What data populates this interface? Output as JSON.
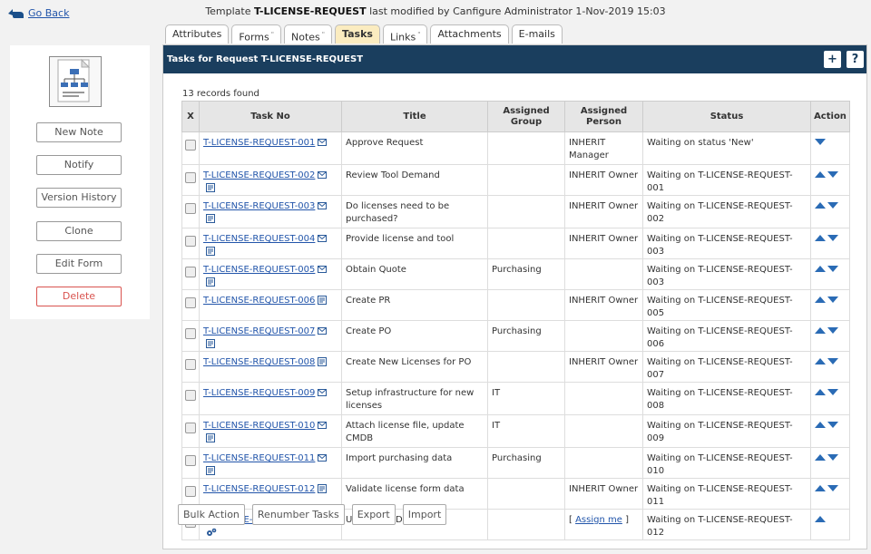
{
  "nav": {
    "go_back": "Go Back"
  },
  "heading": {
    "prefix": "Template",
    "template_name": "T-LICENSE-REQUEST",
    "suffix": "last modified by Canfigure Administrator 1-Nov-2019 15:03"
  },
  "left_buttons": [
    {
      "label": "New Note",
      "style": "normal"
    },
    {
      "label": "Notify",
      "style": "normal"
    },
    {
      "label": "Version History",
      "style": "normal"
    },
    {
      "label": "Clone",
      "style": "normal"
    },
    {
      "label": "Edit Form",
      "style": "normal"
    },
    {
      "label": "Delete",
      "style": "danger"
    }
  ],
  "tabs": [
    {
      "label": "Attributes",
      "marker": "",
      "active": false
    },
    {
      "label": "Forms",
      "marker": "\"",
      "active": false
    },
    {
      "label": "Notes",
      "marker": "\"",
      "active": false
    },
    {
      "label": "Tasks",
      "marker": "",
      "active": true
    },
    {
      "label": "Links",
      "marker": "\"",
      "active": false
    },
    {
      "label": "Attachments",
      "marker": "",
      "active": false
    },
    {
      "label": "E-mails",
      "marker": "",
      "active": false
    }
  ],
  "panel": {
    "title": "Tasks for Request T-LICENSE-REQUEST",
    "add_label": "+",
    "help_label": "?"
  },
  "records_text": "13 records found",
  "columns": {
    "x": "X",
    "task_no": "Task No",
    "title": "Title",
    "assigned_group": "Assigned Group",
    "assigned_person": "Assigned Person",
    "status": "Status",
    "action": "Action"
  },
  "tasks": [
    {
      "task_no": "T-LICENSE-REQUEST-001",
      "icons": [
        "mail"
      ],
      "title": "Approve Request",
      "group": "",
      "person": "INHERIT Manager",
      "status": "Waiting on status 'New'",
      "up": false,
      "down": true
    },
    {
      "task_no": "T-LICENSE-REQUEST-002",
      "icons": [
        "mail",
        "form"
      ],
      "title": "Review Tool Demand",
      "group": "",
      "person": "INHERIT Owner",
      "status": "Waiting on T-LICENSE-REQUEST-001",
      "up": true,
      "down": true
    },
    {
      "task_no": "T-LICENSE-REQUEST-003",
      "icons": [
        "mail",
        "form"
      ],
      "title": "Do licenses need to be purchased?",
      "group": "",
      "person": "INHERIT Owner",
      "status": "Waiting on T-LICENSE-REQUEST-002",
      "up": true,
      "down": true
    },
    {
      "task_no": "T-LICENSE-REQUEST-004",
      "icons": [
        "mail",
        "form"
      ],
      "title": "Provide license and tool",
      "group": "",
      "person": "INHERIT Owner",
      "status": "Waiting on T-LICENSE-REQUEST-003",
      "up": true,
      "down": true
    },
    {
      "task_no": "T-LICENSE-REQUEST-005",
      "icons": [
        "mail",
        "form"
      ],
      "title": "Obtain Quote",
      "group": "Purchasing",
      "person": "",
      "status": "Waiting on T-LICENSE-REQUEST-003",
      "up": true,
      "down": true
    },
    {
      "task_no": "T-LICENSE-REQUEST-006",
      "icons": [
        "form"
      ],
      "title": "Create PR",
      "group": "",
      "person": "INHERIT Owner",
      "status": "Waiting on T-LICENSE-REQUEST-005",
      "up": true,
      "down": true
    },
    {
      "task_no": "T-LICENSE-REQUEST-007",
      "icons": [
        "mail",
        "form"
      ],
      "title": "Create PO",
      "group": "Purchasing",
      "person": "",
      "status": "Waiting on T-LICENSE-REQUEST-006",
      "up": true,
      "down": true
    },
    {
      "task_no": "T-LICENSE-REQUEST-008",
      "icons": [
        "form"
      ],
      "title": "Create New Licenses for PO",
      "group": "",
      "person": "INHERIT Owner",
      "status": "Waiting on T-LICENSE-REQUEST-007",
      "up": true,
      "down": true
    },
    {
      "task_no": "T-LICENSE-REQUEST-009",
      "icons": [
        "mail"
      ],
      "title": "Setup infrastructure for new licenses",
      "group": "IT",
      "person": "",
      "status": "Waiting on T-LICENSE-REQUEST-008",
      "up": true,
      "down": true
    },
    {
      "task_no": "T-LICENSE-REQUEST-010",
      "icons": [
        "mail",
        "form"
      ],
      "title": "Attach license file, update CMDB",
      "group": "IT",
      "person": "",
      "status": "Waiting on T-LICENSE-REQUEST-009",
      "up": true,
      "down": true
    },
    {
      "task_no": "T-LICENSE-REQUEST-011",
      "icons": [
        "mail",
        "form"
      ],
      "title": "Import purchasing data",
      "group": "Purchasing",
      "person": "",
      "status": "Waiting on T-LICENSE-REQUEST-010",
      "up": true,
      "down": true
    },
    {
      "task_no": "T-LICENSE-REQUEST-012",
      "icons": [
        "form"
      ],
      "title": "Validate license form data",
      "group": "",
      "person": "INHERIT Owner",
      "status": "Waiting on T-LICENSE-REQUEST-011",
      "up": true,
      "down": true
    },
    {
      "task_no": "T-LICENSE-REQUEST-013",
      "icons": [
        "form",
        "gears"
      ],
      "title": "Update CMDB",
      "group": "",
      "person": "",
      "person_link": "Assign me",
      "status": "Waiting on T-LICENSE-REQUEST-012",
      "up": true,
      "down": false
    }
  ],
  "bottom_buttons": [
    {
      "label": "Bulk Action"
    },
    {
      "label": "Renumber Tasks"
    },
    {
      "label": "Export"
    },
    {
      "label": "Import"
    }
  ]
}
